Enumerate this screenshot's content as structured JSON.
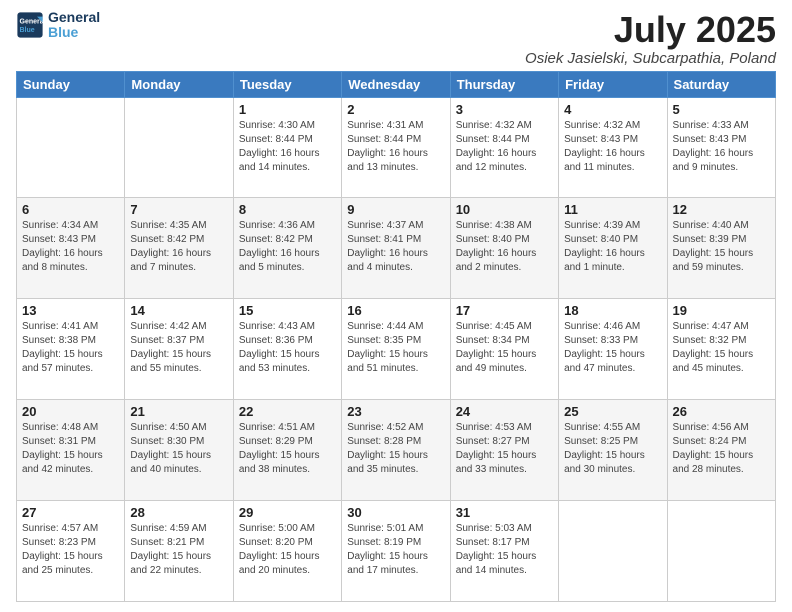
{
  "logo": {
    "line1": "General",
    "line2": "Blue"
  },
  "title": "July 2025",
  "subtitle": "Osiek Jasielski, Subcarpathia, Poland",
  "weekdays": [
    "Sunday",
    "Monday",
    "Tuesday",
    "Wednesday",
    "Thursday",
    "Friday",
    "Saturday"
  ],
  "weeks": [
    [
      {
        "day": "",
        "info": ""
      },
      {
        "day": "",
        "info": ""
      },
      {
        "day": "1",
        "info": "Sunrise: 4:30 AM\nSunset: 8:44 PM\nDaylight: 16 hours and 14 minutes."
      },
      {
        "day": "2",
        "info": "Sunrise: 4:31 AM\nSunset: 8:44 PM\nDaylight: 16 hours and 13 minutes."
      },
      {
        "day": "3",
        "info": "Sunrise: 4:32 AM\nSunset: 8:44 PM\nDaylight: 16 hours and 12 minutes."
      },
      {
        "day": "4",
        "info": "Sunrise: 4:32 AM\nSunset: 8:43 PM\nDaylight: 16 hours and 11 minutes."
      },
      {
        "day": "5",
        "info": "Sunrise: 4:33 AM\nSunset: 8:43 PM\nDaylight: 16 hours and 9 minutes."
      }
    ],
    [
      {
        "day": "6",
        "info": "Sunrise: 4:34 AM\nSunset: 8:43 PM\nDaylight: 16 hours and 8 minutes."
      },
      {
        "day": "7",
        "info": "Sunrise: 4:35 AM\nSunset: 8:42 PM\nDaylight: 16 hours and 7 minutes."
      },
      {
        "day": "8",
        "info": "Sunrise: 4:36 AM\nSunset: 8:42 PM\nDaylight: 16 hours and 5 minutes."
      },
      {
        "day": "9",
        "info": "Sunrise: 4:37 AM\nSunset: 8:41 PM\nDaylight: 16 hours and 4 minutes."
      },
      {
        "day": "10",
        "info": "Sunrise: 4:38 AM\nSunset: 8:40 PM\nDaylight: 16 hours and 2 minutes."
      },
      {
        "day": "11",
        "info": "Sunrise: 4:39 AM\nSunset: 8:40 PM\nDaylight: 16 hours and 1 minute."
      },
      {
        "day": "12",
        "info": "Sunrise: 4:40 AM\nSunset: 8:39 PM\nDaylight: 15 hours and 59 minutes."
      }
    ],
    [
      {
        "day": "13",
        "info": "Sunrise: 4:41 AM\nSunset: 8:38 PM\nDaylight: 15 hours and 57 minutes."
      },
      {
        "day": "14",
        "info": "Sunrise: 4:42 AM\nSunset: 8:37 PM\nDaylight: 15 hours and 55 minutes."
      },
      {
        "day": "15",
        "info": "Sunrise: 4:43 AM\nSunset: 8:36 PM\nDaylight: 15 hours and 53 minutes."
      },
      {
        "day": "16",
        "info": "Sunrise: 4:44 AM\nSunset: 8:35 PM\nDaylight: 15 hours and 51 minutes."
      },
      {
        "day": "17",
        "info": "Sunrise: 4:45 AM\nSunset: 8:34 PM\nDaylight: 15 hours and 49 minutes."
      },
      {
        "day": "18",
        "info": "Sunrise: 4:46 AM\nSunset: 8:33 PM\nDaylight: 15 hours and 47 minutes."
      },
      {
        "day": "19",
        "info": "Sunrise: 4:47 AM\nSunset: 8:32 PM\nDaylight: 15 hours and 45 minutes."
      }
    ],
    [
      {
        "day": "20",
        "info": "Sunrise: 4:48 AM\nSunset: 8:31 PM\nDaylight: 15 hours and 42 minutes."
      },
      {
        "day": "21",
        "info": "Sunrise: 4:50 AM\nSunset: 8:30 PM\nDaylight: 15 hours and 40 minutes."
      },
      {
        "day": "22",
        "info": "Sunrise: 4:51 AM\nSunset: 8:29 PM\nDaylight: 15 hours and 38 minutes."
      },
      {
        "day": "23",
        "info": "Sunrise: 4:52 AM\nSunset: 8:28 PM\nDaylight: 15 hours and 35 minutes."
      },
      {
        "day": "24",
        "info": "Sunrise: 4:53 AM\nSunset: 8:27 PM\nDaylight: 15 hours and 33 minutes."
      },
      {
        "day": "25",
        "info": "Sunrise: 4:55 AM\nSunset: 8:25 PM\nDaylight: 15 hours and 30 minutes."
      },
      {
        "day": "26",
        "info": "Sunrise: 4:56 AM\nSunset: 8:24 PM\nDaylight: 15 hours and 28 minutes."
      }
    ],
    [
      {
        "day": "27",
        "info": "Sunrise: 4:57 AM\nSunset: 8:23 PM\nDaylight: 15 hours and 25 minutes."
      },
      {
        "day": "28",
        "info": "Sunrise: 4:59 AM\nSunset: 8:21 PM\nDaylight: 15 hours and 22 minutes."
      },
      {
        "day": "29",
        "info": "Sunrise: 5:00 AM\nSunset: 8:20 PM\nDaylight: 15 hours and 20 minutes."
      },
      {
        "day": "30",
        "info": "Sunrise: 5:01 AM\nSunset: 8:19 PM\nDaylight: 15 hours and 17 minutes."
      },
      {
        "day": "31",
        "info": "Sunrise: 5:03 AM\nSunset: 8:17 PM\nDaylight: 15 hours and 14 minutes."
      },
      {
        "day": "",
        "info": ""
      },
      {
        "day": "",
        "info": ""
      }
    ]
  ]
}
